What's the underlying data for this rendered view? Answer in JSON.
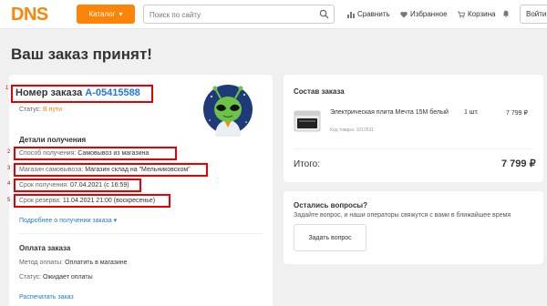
{
  "header": {
    "logo": "DNS",
    "catalog_label": "Каталог",
    "search_placeholder": "Поиск по сайту",
    "nav": {
      "compare": "Сравнить",
      "favorites": "Избранное",
      "cart": "Корзина",
      "login": "Войти"
    }
  },
  "page_title": "Ваш заказ принят!",
  "order": {
    "number_label": "Номер заказа",
    "number": "А-05415588",
    "status_label": "Статус:",
    "status_value": "В пути",
    "markers": [
      "1",
      "2",
      "3",
      "4",
      "5"
    ],
    "details_title": "Детали получения",
    "pickup_method_label": "Способ получения:",
    "pickup_method_value": "Самовывоз из магазина",
    "store_label": "Магазин самовывоза:",
    "store_value": "Магазин склад на \"Мельниковском\"",
    "pickup_date_label": "Срок получения:",
    "pickup_date_value": "07.04.2021 (с 16:59)",
    "reserve_label": "Срок резерва:",
    "reserve_value": "11.04.2021 21:00 (воскресенье)",
    "more_link": "Подробнее о получении заказа",
    "payment_title": "Оплата заказа",
    "payment_method_label": "Метод оплаты:",
    "payment_method_value": "Оплатить в магазине",
    "payment_status_label": "Статус:",
    "payment_status_value": "Ожидает оплаты",
    "unpack_link": "Распечатать заказ"
  },
  "composition": {
    "title": "Состав заказа",
    "product_name": "Электрическая плита Мечта 15М белый",
    "product_code": "Код товара: 1012631",
    "qty": "1 шт.",
    "price": "7 799 ₽",
    "total_label": "Итого:",
    "total_value": "7 799 ₽"
  },
  "questions": {
    "title": "Остались вопросы?",
    "text": "Задайте вопрос, и наши операторы свяжутся с вами в ближайшее время",
    "button": "Задать вопрос"
  },
  "colors": {
    "brand_orange": "#fc8507",
    "link_blue": "#1e7ad6",
    "highlight_red": "#e60000"
  }
}
